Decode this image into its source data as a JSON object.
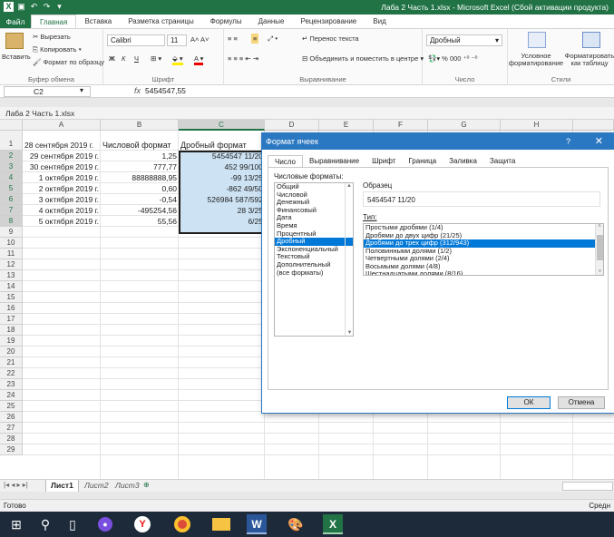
{
  "window": {
    "title": "Лаба 2 Часть 1.xlsx - Microsoft Excel (Сбой активации продукта)"
  },
  "ribbon_tabs": [
    "Файл",
    "Главная",
    "Вставка",
    "Разметка страницы",
    "Формулы",
    "Данные",
    "Рецензирование",
    "Вид"
  ],
  "clipboard": {
    "paste": "Вставить",
    "cut": "Вырезать",
    "copy": "Копировать",
    "format_painter": "Формат по образцу",
    "label": "Буфер обмена"
  },
  "font": {
    "name": "Calibri",
    "size": "11",
    "label": "Шрифт",
    "bold": "Ж",
    "italic": "К",
    "underline": "Ч"
  },
  "alignment": {
    "wrap": "Перенос текста",
    "merge": "Объединить и поместить в центре",
    "label": "Выравнивание"
  },
  "number": {
    "format": "Дробный",
    "label": "Число"
  },
  "styles": {
    "conditional": "Условное форматирование",
    "as_table": "Форматировать как таблицу",
    "label": "Стили"
  },
  "formula_bar": {
    "name_box": "C2",
    "fx": "fx",
    "value": "5454547,55"
  },
  "workbook_title": "Лаба 2 Часть 1.xlsx",
  "columns": [
    "A",
    "B",
    "C",
    "D",
    "E",
    "F",
    "G",
    "H"
  ],
  "rows": [
    "1",
    "2",
    "3",
    "4",
    "5",
    "6",
    "7",
    "8",
    "9",
    "10",
    "11",
    "12",
    "13",
    "14",
    "15",
    "16",
    "17",
    "18",
    "19",
    "20",
    "21",
    "22",
    "23",
    "24",
    "25",
    "26",
    "27",
    "28",
    "29"
  ],
  "table": [
    {
      "a": "28 сентября 2019 г.",
      "b": "Числовой формат",
      "c": "Дробный формат"
    },
    {
      "a": "29 сентября 2019 г.",
      "b": "1,25",
      "c": "5454547  11/20"
    },
    {
      "a": "30 сентября 2019 г.",
      "b": "777,77",
      "c": "452  99/100"
    },
    {
      "a": "1 октября 2019 г.",
      "b": "88888888,95",
      "c": "-99  13/25"
    },
    {
      "a": "2 октября 2019 г.",
      "b": "0,60",
      "c": "-862  49/50"
    },
    {
      "a": "3 октября 2019 г.",
      "b": "-0,54",
      "c": "526984 587/592"
    },
    {
      "a": "4 октября 2019 г.",
      "b": "-495254,56",
      "c": "28    3/25"
    },
    {
      "a": "5 октября 2019 г.",
      "b": "55,56",
      "c": "6/25"
    }
  ],
  "sheet_tabs": [
    "Лист1",
    "Лист2",
    "Лист3"
  ],
  "status": {
    "ready": "Готово",
    "right": "Средн"
  },
  "dialog": {
    "title": "Формат ячеек",
    "help": "?",
    "close": "✕",
    "tabs": [
      "Число",
      "Выравнивание",
      "Шрифт",
      "Граница",
      "Заливка",
      "Защита"
    ],
    "categories_label": "Числовые форматы:",
    "categories": [
      "Общий",
      "Числовой",
      "Денежный",
      "Финансовый",
      "Дата",
      "Время",
      "Процентный",
      "Дробный",
      "Экспоненциальный",
      "Текстовый",
      "Дополнительный",
      "(все форматы)"
    ],
    "selected_category": "Дробный",
    "sample_label": "Образец",
    "sample_value": "5454547  11/20",
    "type_label": "Тип:",
    "types": [
      "Простыми дробями (1/4)",
      "Дробями до двух цифр (21/25)",
      "Дробями до трех цифр (312/943)",
      "Половинными долями (1/2)",
      "Четвертными долями (2/4)",
      "Восьмыми долями (4/8)",
      "Шестнадцатыми долями (8/16)"
    ],
    "selected_type": "Дробями до трех цифр (312/943)",
    "ok": "ОК",
    "cancel": "Отмена"
  },
  "taskbar": [
    "start-icon",
    "search-icon",
    "task-view-icon",
    "alice-icon",
    "yandex-browser-icon",
    "chrome-icon",
    "file-explorer-icon",
    "word-icon",
    "paint-icon",
    "excel-icon"
  ]
}
